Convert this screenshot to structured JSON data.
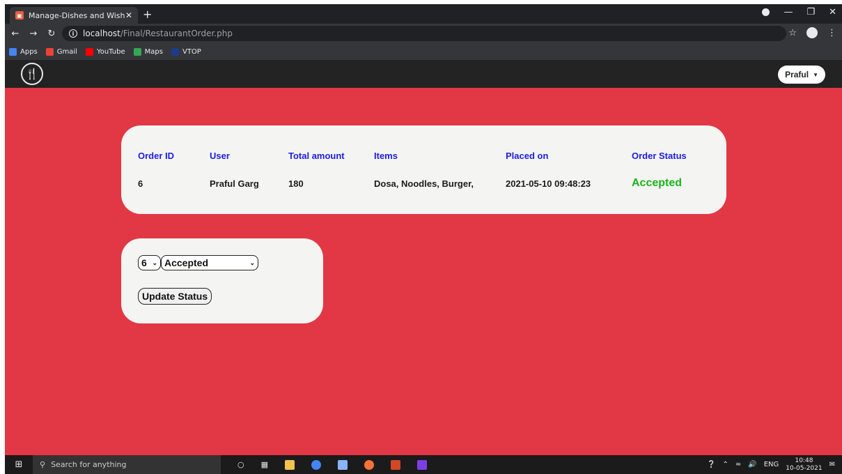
{
  "browser": {
    "tab_title": "Manage-Dishes and Wishes",
    "tab_close": "✕",
    "new_tab": "+",
    "url_host": "localhost",
    "url_path": "/Final/RestaurantOrder.php",
    "bookmarks": [
      {
        "label": "Apps",
        "color": "#4285f4"
      },
      {
        "label": "Gmail",
        "color": "#ea4335"
      },
      {
        "label": "YouTube",
        "color": "#ff0000"
      },
      {
        "label": "Maps",
        "color": "#34a853"
      },
      {
        "label": "VTOP",
        "color": "#1a3c8a"
      }
    ]
  },
  "site": {
    "user_button": "Praful",
    "accent_color": "#e23744"
  },
  "orders": {
    "headers": [
      "Order ID",
      "User",
      "Total amount",
      "Items",
      "Placed on",
      "Order Status"
    ],
    "row": [
      "6",
      "Praful Garg",
      "180",
      "Dosa, Noodles, Burger,",
      "2021-05-10 09:48:23",
      "Accepted"
    ]
  },
  "update_form": {
    "order_select_value": "6",
    "status_select_value": "Accepted",
    "submit_label": "Update Status"
  },
  "taskbar": {
    "search_placeholder": "Search for anything",
    "lang": "ENG",
    "time": "10:48",
    "date": "10-05-2021"
  }
}
